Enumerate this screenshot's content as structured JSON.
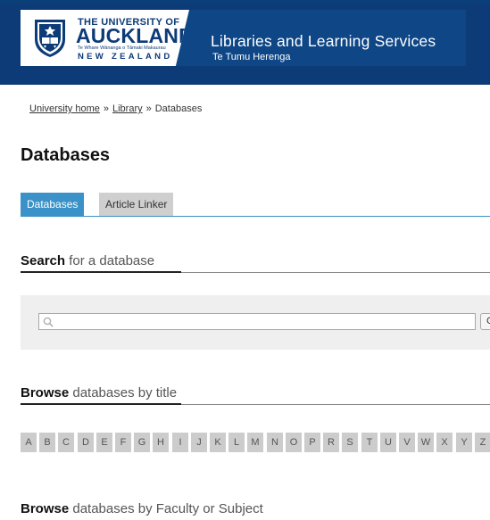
{
  "header": {
    "university_line1": "THE UNIVERSITY OF",
    "university_line2": "AUCKLAND",
    "university_line3": "Te Whare Wānanga o Tāmaki Makaurau",
    "university_line4": "NEW ZEALAND",
    "site_title": "Libraries and Learning Services",
    "site_subtitle": "Te Tumu Herenga",
    "colors": {
      "header_bg": "#0d3b78",
      "accent": "#3a92c9"
    }
  },
  "breadcrumb": {
    "items": [
      "University home",
      "Library",
      "Databases"
    ],
    "separator": "»"
  },
  "page_title": "Databases",
  "tabs": [
    {
      "label": "Databases",
      "active": true
    },
    {
      "label": "Article Linker",
      "active": false
    }
  ],
  "search_section": {
    "heading_strong": "Search",
    "heading_light": " for a database",
    "input_value": "",
    "input_placeholder": "",
    "button_label": "Go"
  },
  "browse_title_section": {
    "heading_strong": "Browse",
    "heading_light": " databases by title",
    "letters": [
      "A",
      "B",
      "C",
      "D",
      "E",
      "F",
      "G",
      "H",
      "I",
      "J",
      "K",
      "L",
      "M",
      "N",
      "O",
      "P",
      "R",
      "S",
      "T",
      "U",
      "V",
      "W",
      "X",
      "Y",
      "Z"
    ]
  },
  "browse_subject_section": {
    "heading_strong": "Browse",
    "heading_light": " databases by Faculty or Subject"
  }
}
